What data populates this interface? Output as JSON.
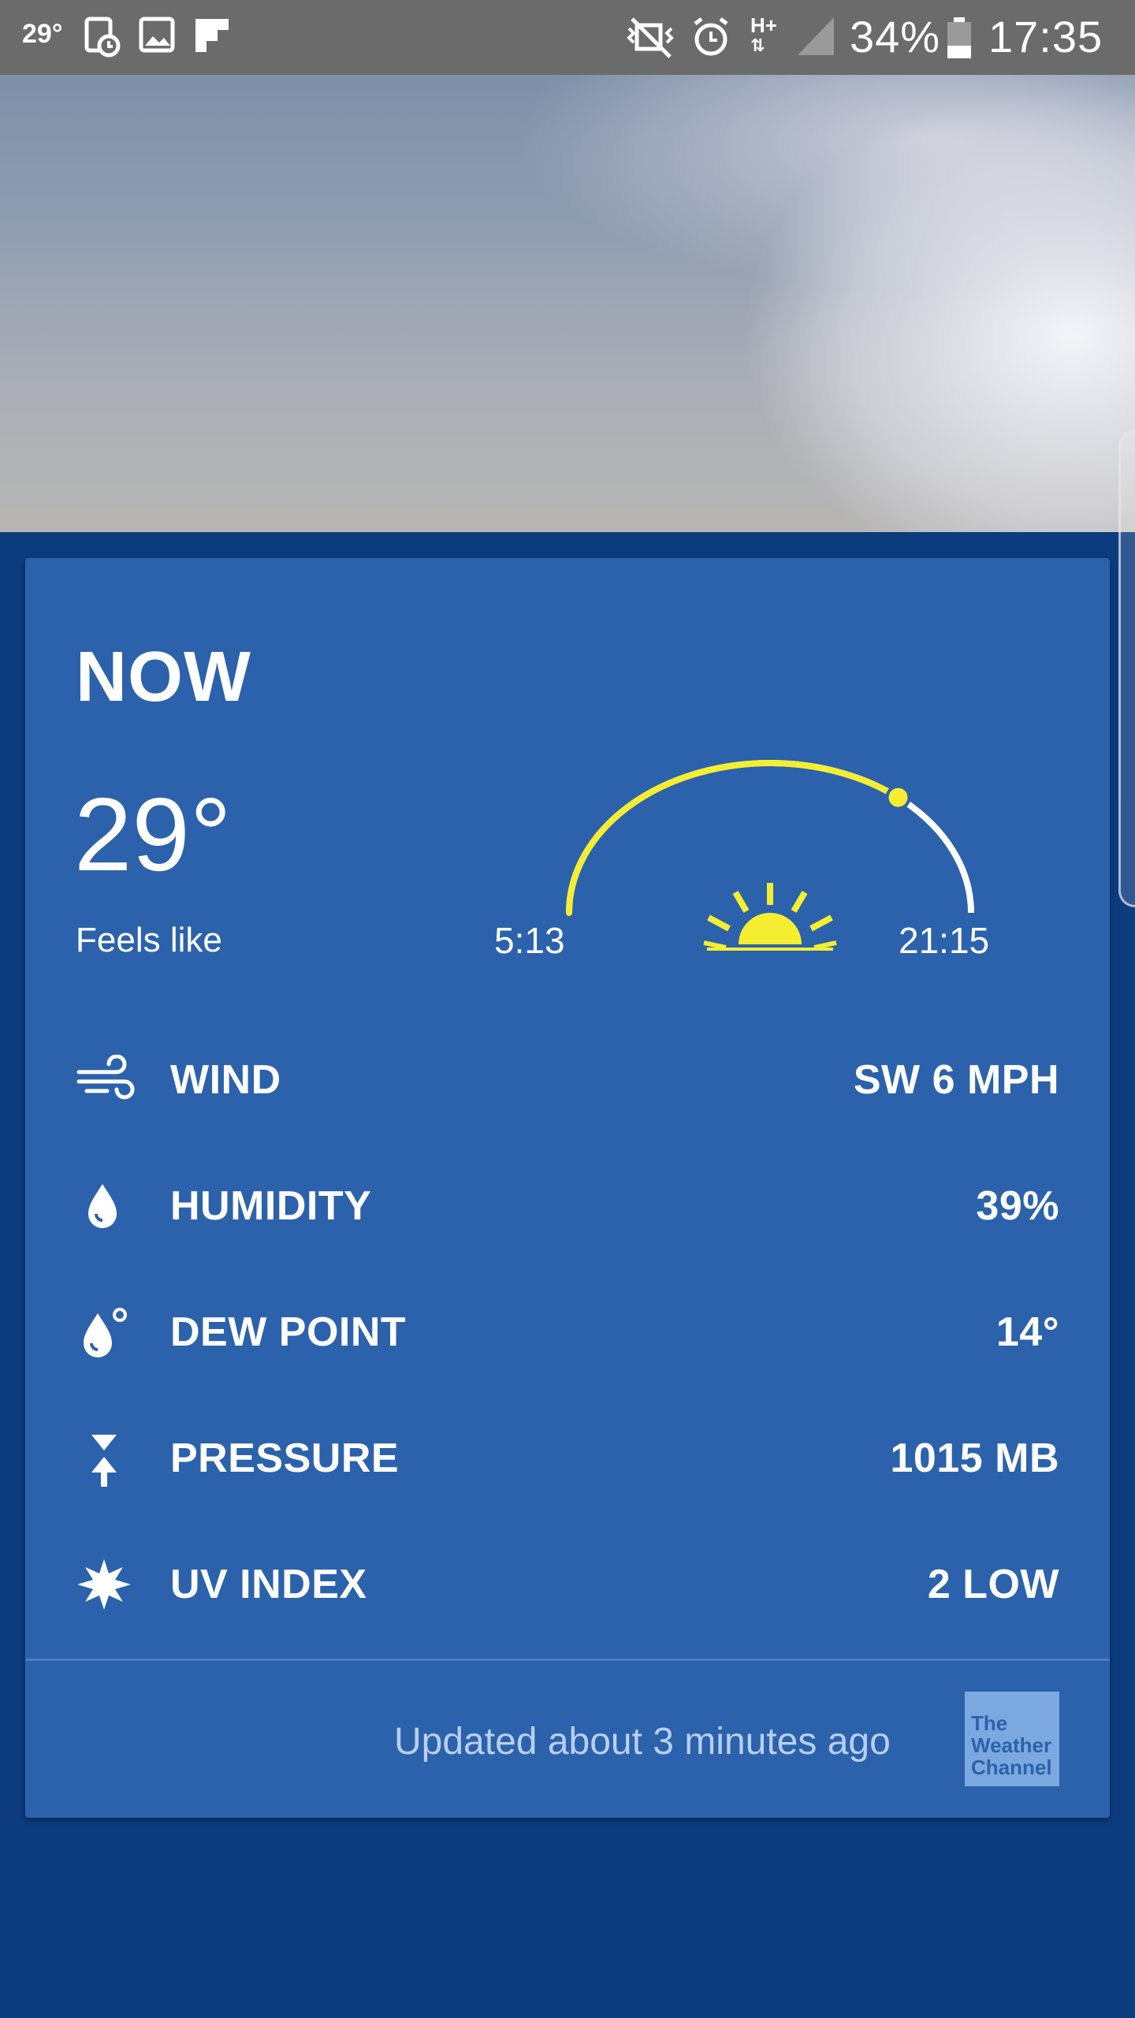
{
  "status_bar": {
    "temperature": "29°",
    "battery_percent": "34%",
    "time": "17:35",
    "network_type": "H+",
    "icons": [
      "notification-temp-icon",
      "calendar-icon",
      "image-icon",
      "flipboard-icon",
      "mute-icon",
      "alarm-icon",
      "data-arrows-icon",
      "signal-icon",
      "battery-icon"
    ]
  },
  "card": {
    "title": "NOW",
    "temperature": "29°",
    "feels_like_label": "Feels like",
    "sunrise": "5:13",
    "sunset": "21:15",
    "daylight_progress": 0.72,
    "details": [
      {
        "icon": "wind-icon",
        "label": "WIND",
        "value": "SW 6 MPH"
      },
      {
        "icon": "humidity-icon",
        "label": "HUMIDITY",
        "value": "39%"
      },
      {
        "icon": "dew-point-icon",
        "label": "DEW POINT",
        "value": "14°"
      },
      {
        "icon": "pressure-icon",
        "label": "PRESSURE",
        "value": "1015 MB"
      },
      {
        "icon": "uv-index-icon",
        "label": "UV INDEX",
        "value": "2 LOW"
      }
    ],
    "updated_text": "Updated about 3 minutes ago",
    "logo_text": [
      "The",
      "Weather",
      "Channel"
    ]
  },
  "colors": {
    "accent_yellow": "#f5ee30",
    "card_blue": "#2b62ab",
    "background_blue": "#0d3c7e"
  }
}
